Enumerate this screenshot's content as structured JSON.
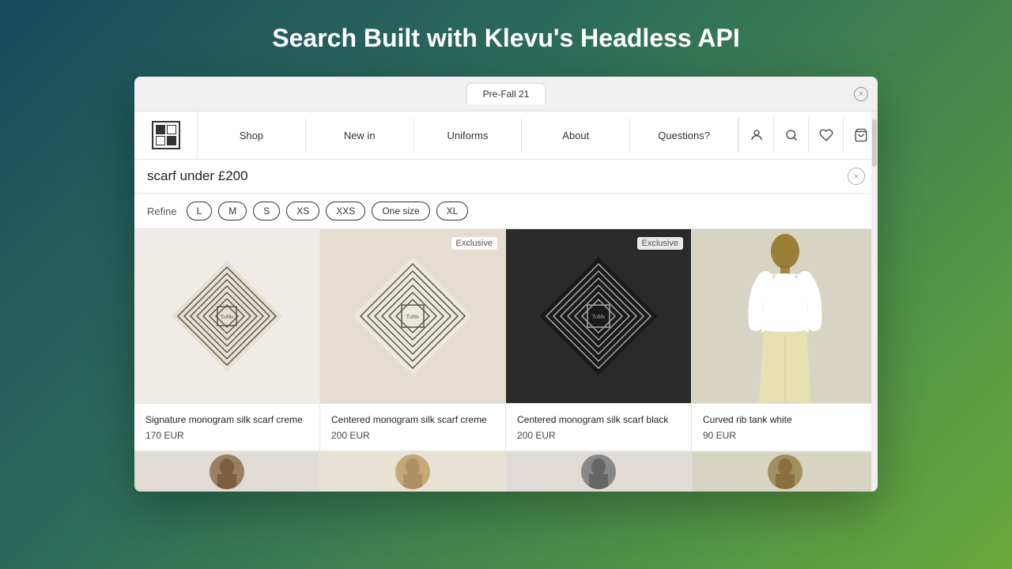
{
  "page": {
    "title": "Search Built with Klevu's Headless API"
  },
  "browser": {
    "tab_label": "Pre-Fall 21",
    "close_label": "×"
  },
  "nav": {
    "logo_alt": "Brand Logo",
    "items": [
      {
        "label": "Shop"
      },
      {
        "label": "New in"
      },
      {
        "label": "Uniforms"
      },
      {
        "label": "About"
      },
      {
        "label": "Questions?"
      }
    ],
    "actions": [
      {
        "icon": "👤",
        "name": "account-icon"
      },
      {
        "icon": "🔍",
        "name": "search-icon"
      },
      {
        "icon": "☆",
        "name": "wishlist-icon"
      },
      {
        "icon": "🛍",
        "name": "cart-icon"
      }
    ]
  },
  "search": {
    "value": "scarf under £200",
    "clear_label": "×"
  },
  "refine": {
    "label": "Refine",
    "sizes": [
      "L",
      "M",
      "S",
      "XS",
      "XXS",
      "One size",
      "XL"
    ]
  },
  "products": [
    {
      "id": 1,
      "name": "Signature monogram silk scarf creme",
      "price": "170 EUR",
      "badge": "",
      "bg": "creme"
    },
    {
      "id": 2,
      "name": "Centered monogram silk scarf creme",
      "price": "200 EUR",
      "badge": "Exclusive",
      "bg": "creme"
    },
    {
      "id": 3,
      "name": "Centered monogram silk scarf black",
      "price": "200 EUR",
      "badge": "Exclusive",
      "bg": "dark"
    },
    {
      "id": 4,
      "name": "Curved rib tank white",
      "price": "90 EUR",
      "badge": "",
      "bg": "model"
    }
  ]
}
